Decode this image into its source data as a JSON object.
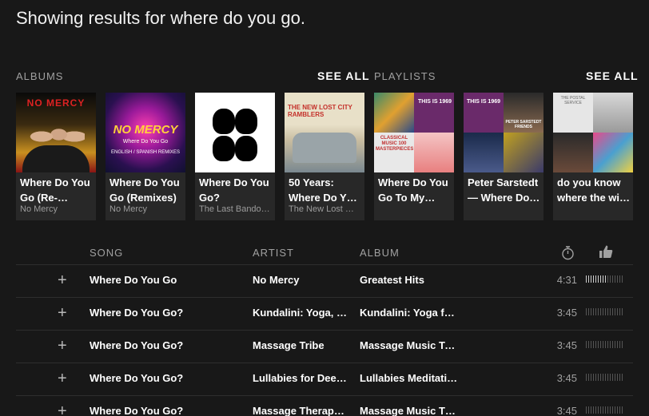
{
  "results_title": "Showing results for where do you go.",
  "albums": {
    "label": "ALBUMS",
    "see_all": "SEE ALL",
    "items": [
      {
        "title": "Where Do You Go (Re-…",
        "subtitle": "No Mercy",
        "art_text": "NO MERCY"
      },
      {
        "title": "Where Do You Go (Remixes)",
        "subtitle": "No Mercy",
        "art_text": "NO MERCY",
        "art_sub": "Where Do You Go",
        "art_sub2": "ENGLISH / SPANISH REMIXES"
      },
      {
        "title": "Where Do You Go?",
        "subtitle": "The Last Bando…"
      },
      {
        "title": "50 Years: Where Do Y…",
        "subtitle": "The New Lost …",
        "art_text": "THE NEW LOST CITY RAMBLERS"
      }
    ]
  },
  "playlists": {
    "label": "PLAYLISTS",
    "see_all": "SEE ALL",
    "items": [
      {
        "title": "Where Do You Go To My…",
        "art_text": "THIS IS 1969",
        "art_text2": "CLASSICAL MUSIC 100 MASTERPIECES"
      },
      {
        "title": "Peter Sarstedt — Where Do…",
        "art_text": "THIS IS 1969",
        "art_text2": "PETER SARSTEDT FRIENDS"
      },
      {
        "title": "do you know where the wi…",
        "art_text": "THE POSTAL SERVICE"
      }
    ]
  },
  "tracklist": {
    "columns": {
      "song": "SONG",
      "artist": "ARTIST",
      "album": "ALBUM"
    },
    "icons": {
      "duration": "stopwatch-icon",
      "popularity": "thumbs-up-icon",
      "add": "plus-icon"
    },
    "rows": [
      {
        "song": "Where Do You Go",
        "artist": "No Mercy",
        "album": "Greatest Hits",
        "duration": "4:31",
        "popularity": 0.55
      },
      {
        "song": "Where Do You Go?",
        "artist": "Kundalini: Yoga, …",
        "album": "Kundalini: Yoga fo…",
        "duration": "3:45",
        "popularity": 0.0
      },
      {
        "song": "Where Do You Go?",
        "artist": "Massage Tribe",
        "album": "Massage Music Tr…",
        "duration": "3:45",
        "popularity": 0.0
      },
      {
        "song": "Where Do You Go?",
        "artist": "Lullabies for Deep…",
        "album": "Lullabies Meditati…",
        "duration": "3:45",
        "popularity": 0.0
      },
      {
        "song": "Where Do You Go?",
        "artist": "Massage Therapy…",
        "album": "Massage Music T…",
        "duration": "3:45",
        "popularity": 0.0
      }
    ]
  },
  "colors": {
    "background": "#181818",
    "card": "#282828",
    "muted": "#a0a0a0"
  }
}
